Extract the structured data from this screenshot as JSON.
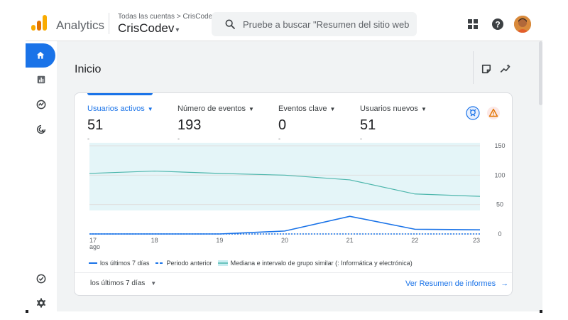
{
  "header": {
    "product_name": "Analytics",
    "breadcrumb": "Todas las cuentas > CrisCodev",
    "account_name": "CrisCodev",
    "account_caret": "▾",
    "search_placeholder": "Pruebe a buscar \"Resumen del sitio web\"",
    "icons": [
      "apps-grid-icon",
      "help-icon",
      "user-avatar"
    ]
  },
  "sidebar": {
    "items": [
      {
        "name": "home",
        "icon": "home-icon",
        "active": true
      },
      {
        "name": "reports",
        "icon": "bar-chart-icon",
        "active": false
      },
      {
        "name": "explore",
        "icon": "explore-icon",
        "active": false
      },
      {
        "name": "advertising",
        "icon": "advertising-icon",
        "active": false
      },
      {
        "name": "admin-insights",
        "icon": "check-circle-icon",
        "active": false
      },
      {
        "name": "settings",
        "icon": "gear-icon",
        "active": false
      }
    ]
  },
  "page": {
    "title": "Inicio",
    "tool_icons": [
      "notes-icon",
      "insights-icon"
    ]
  },
  "card": {
    "metrics": [
      {
        "label": "Usuarios activos",
        "value": "51",
        "sub": "-",
        "active": true
      },
      {
        "label": "Número de eventos",
        "value": "193",
        "sub": "-",
        "active": false
      },
      {
        "label": "Eventos clave",
        "value": "0",
        "sub": "-",
        "active": false
      },
      {
        "label": "Usuarios nuevos",
        "value": "51",
        "sub": "-",
        "active": false
      }
    ],
    "caret": "▼",
    "badges": [
      "benchmark-icon",
      "warning-icon"
    ],
    "legend": {
      "current": "los últimos 7 días",
      "previous": "Periodo anterior",
      "benchmark": "Mediana e intervalo de grupo similar (: Informática y electrónica)"
    },
    "period_selector": "los últimos 7 días",
    "period_caret": "▼",
    "report_link": "Ver Resumen de informes",
    "report_arrow": "→"
  },
  "chart_data": {
    "type": "line",
    "x": [
      "17",
      "18",
      "19",
      "20",
      "21",
      "22",
      "23"
    ],
    "x_sublabel": "ago",
    "y_ticks": [
      "150",
      "100",
      "50",
      "0"
    ],
    "ylim": [
      0,
      150
    ],
    "series": [
      {
        "name": "los últimos 7 días",
        "style": "solid",
        "color": "#1a73e8",
        "values": [
          0,
          0,
          0,
          5,
          30,
          8,
          7
        ]
      },
      {
        "name": "Periodo anterior",
        "style": "dashed",
        "color": "#1a73e8",
        "values": [
          0,
          0,
          0,
          0,
          0,
          0,
          0
        ]
      },
      {
        "name": "Mediana e intervalo de grupo similar (: Informática y electrónica)",
        "style": "solid",
        "color": "#4db6ac",
        "values": [
          103,
          107,
          103,
          100,
          92,
          68,
          64
        ]
      }
    ],
    "band": {
      "upper": 155,
      "lower": 40,
      "color": "#e4f5f8"
    },
    "grid": true
  }
}
